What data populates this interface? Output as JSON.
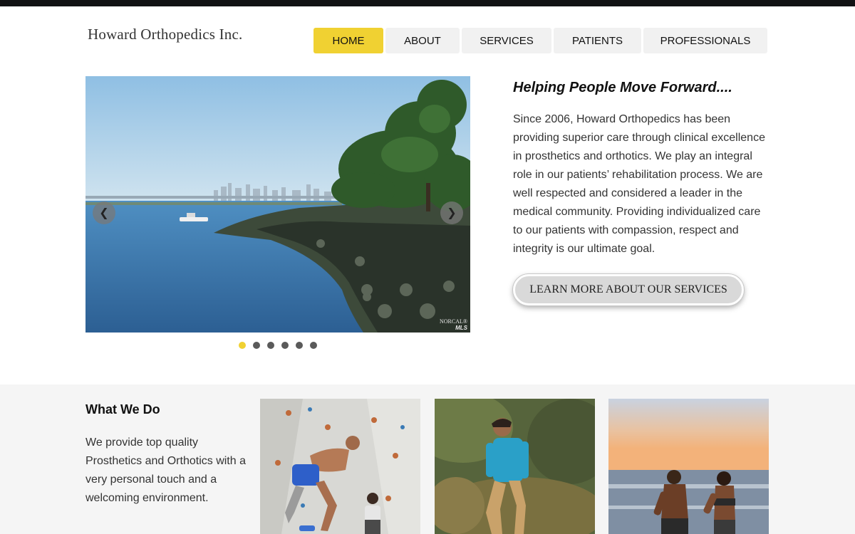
{
  "header": {
    "logo": "Howard Orthopedics Inc.",
    "nav": [
      {
        "label": "HOME",
        "active": true
      },
      {
        "label": "ABOUT",
        "active": false
      },
      {
        "label": "SERVICES",
        "active": false
      },
      {
        "label": "PATIENTS",
        "active": false
      },
      {
        "label": "PROFESSIONALS",
        "active": false
      }
    ]
  },
  "slider": {
    "watermark_line1": "NORCAL®",
    "watermark_line2": "MLS",
    "slide_count": 6,
    "active_slide": 1,
    "prev_icon": "chevron-left-icon",
    "next_icon": "chevron-right-icon"
  },
  "hero": {
    "title": "Helping People Move Forward....",
    "body": "Since 2006, Howard Orthopedics has been providing superior care through clinical excellence in prosthetics and orthotics. We play an integral role in our patients’ rehabilitation process. We are well respected and considered a leader in the medical community. Providing individualized care to our patients with compassion, respect and integrity is our ultimate goal.",
    "cta": "LEARN MORE ABOUT OUR SERVICES"
  },
  "what_we_do": {
    "title": "What We Do",
    "body": "We provide top quality Prosthetics and Orthotics with a very personal touch and a welcoming environment."
  },
  "colors": {
    "accent": "#f0d132",
    "topbar": "#111214",
    "nav_bg": "#f1f1f1",
    "section_bg": "#f5f5f5"
  }
}
